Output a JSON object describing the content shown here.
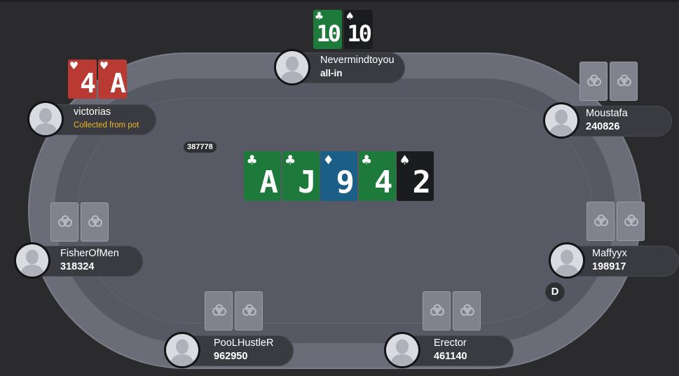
{
  "pot": "387778",
  "dealer_button": "D",
  "board": [
    {
      "rank": "A",
      "suit": "♣",
      "suit_name": "clubs",
      "color": "#1e7a3a"
    },
    {
      "rank": "J",
      "suit": "♣",
      "suit_name": "clubs",
      "color": "#1e7a3a"
    },
    {
      "rank": "9",
      "suit": "♦",
      "suit_name": "diamonds",
      "color": "#1b5f86"
    },
    {
      "rank": "4",
      "suit": "♣",
      "suit_name": "clubs",
      "color": "#1e7a3a"
    },
    {
      "rank": "2",
      "suit": "♠",
      "suit_name": "spades",
      "color": "#1b1c1e"
    }
  ],
  "players": {
    "nevermindtoyou": {
      "name": "Nevermindtoyou",
      "info": "all-in",
      "cards": [
        {
          "rank": "10",
          "suit": "♣"
        },
        {
          "rank": "10",
          "suit": "♠"
        }
      ]
    },
    "victorias": {
      "name": "victorias",
      "info": "Collected from pot",
      "cards": [
        {
          "rank": "4",
          "suit": "♥"
        },
        {
          "rank": "A",
          "suit": "♥"
        }
      ]
    },
    "moustafa": {
      "name": "Moustafa",
      "info": "240826"
    },
    "fisherofmen": {
      "name": "FisherOfMen",
      "info": "318324"
    },
    "maffyyx": {
      "name": "Maffyyx",
      "info": "198917"
    },
    "poolhustler": {
      "name": "PooLHustleR",
      "info": "962950"
    },
    "erector": {
      "name": "Erector",
      "info": "461140"
    }
  },
  "icons": {
    "card_back": "card-back-logo-icon",
    "avatar": "avatar-silhouette-icon"
  }
}
